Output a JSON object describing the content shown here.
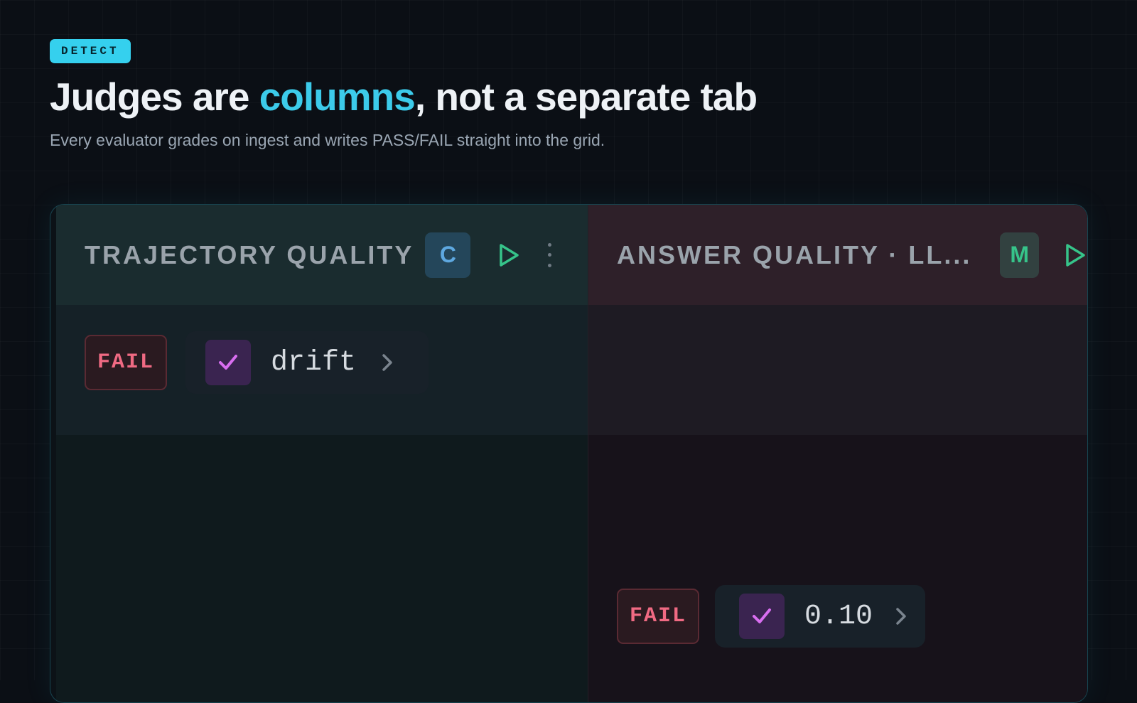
{
  "badge": "DETECT",
  "headline": {
    "before": "Judges are ",
    "accent": "columns",
    "after": ", not a separate tab"
  },
  "subtitle": "Every evaluator grades on ingest and writes PASS/FAIL straight into the grid.",
  "columns": [
    {
      "title": "TRAJECTORY QUALITY",
      "chip_letter": "C",
      "chip_color": "#5ea8e0",
      "row": {
        "status": "FAIL",
        "value": "drift"
      }
    },
    {
      "title": "ANSWER QUALITY · LL...",
      "chip_letter": "M",
      "chip_color": "#36c48a",
      "row": {
        "status": "FAIL",
        "value": "0.10"
      }
    }
  ],
  "colors": {
    "accent": "#3ccbea",
    "fail": "#f06a83",
    "play": "#36c48a",
    "check": "#d86ef0"
  },
  "icons": [
    "play-icon",
    "more-vertical-icon",
    "check-icon",
    "chevron-right-icon"
  ]
}
